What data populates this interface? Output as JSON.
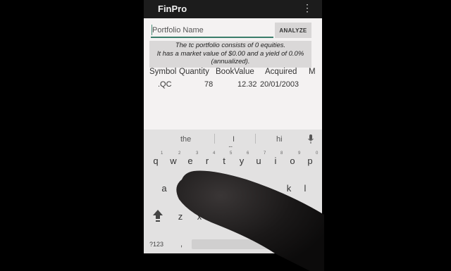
{
  "app": {
    "title": "FinPro",
    "menu_icon": "overflow-menu-icon"
  },
  "portfolio": {
    "placeholder": "Portfolio Name",
    "analyze_label": "ANALYZE",
    "summary": {
      "line1": "The tc portfolio consists of 0 equities.",
      "line2": "It has a market value of $0.00 and a yield of 0.0%",
      "line3": "(annualized)."
    }
  },
  "table": {
    "headers": [
      "Symbol",
      "Quantity",
      "BookValue",
      "Acquired",
      "M"
    ],
    "rows": [
      {
        "symbol": ".QC",
        "quantity": "78",
        "book_value": "12.32",
        "acquired": "20/01/2003"
      }
    ]
  },
  "keyboard": {
    "suggestions": [
      "the",
      "I",
      "hi"
    ],
    "more_indicator": "...",
    "mic_icon": "microphone-icon",
    "row1": [
      "q",
      "w",
      "e",
      "r",
      "t",
      "y",
      "u",
      "i",
      "o",
      "p"
    ],
    "row1_hints": [
      "1",
      "2",
      "3",
      "4",
      "5",
      "6",
      "7",
      "8",
      "9",
      "0"
    ],
    "row2_visible": [
      "a",
      "k",
      "l"
    ],
    "row3_visible": [
      "z",
      "x"
    ],
    "shift_icon": "shift-icon",
    "symbols_label": "?123",
    "comma_label": ","
  },
  "colors": {
    "appbar": "#1c1c1c",
    "accent": "#3a7d6a",
    "background": "#eceaea"
  }
}
